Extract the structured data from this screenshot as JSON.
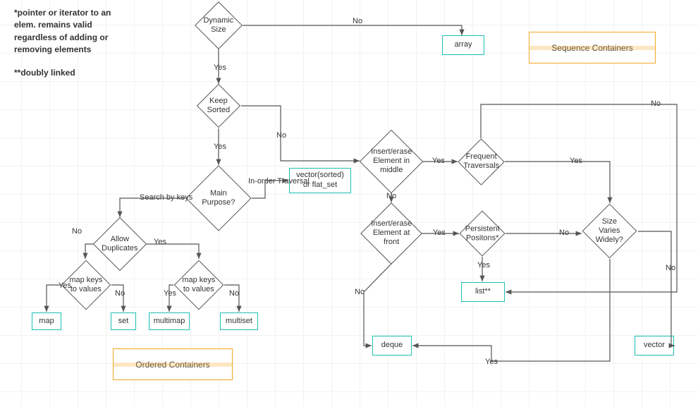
{
  "notes": {
    "footnote1": "*pointer or iterator to an elem. remains valid regardless of adding or removing elements",
    "footnote2": "**doubly linked"
  },
  "banners": {
    "sequence": "Sequence Containers",
    "ordered": "Ordered Containers"
  },
  "decisions": {
    "dynamic_size": "Dynamic Size",
    "keep_sorted": "Keep Sorted",
    "main_purpose": "Main Purpose?",
    "allow_duplicates": "Allow Duplicates",
    "map_keys_left": "map keys to values",
    "map_keys_right": "map keys to values",
    "insert_middle": "Insert/erase Element in middle",
    "frequent_traversals": "Frequent Traversals",
    "insert_front": "Insert/erase Element at front",
    "persistent_positions": "Persistent Positons*",
    "size_varies": "Size Varies Widely?"
  },
  "results": {
    "array": "array",
    "vector_sorted": "vector(sorted) or flat_set",
    "map": "map",
    "set": "set",
    "multimap": "multimap",
    "multiset": "multiset",
    "list": "list**",
    "deque": "deque",
    "vector": "vector"
  },
  "edge_labels": {
    "no": "No",
    "yes": "Yes",
    "search_by_keys": "Search by keys",
    "inorder_traversal": "In-order Traversal"
  }
}
